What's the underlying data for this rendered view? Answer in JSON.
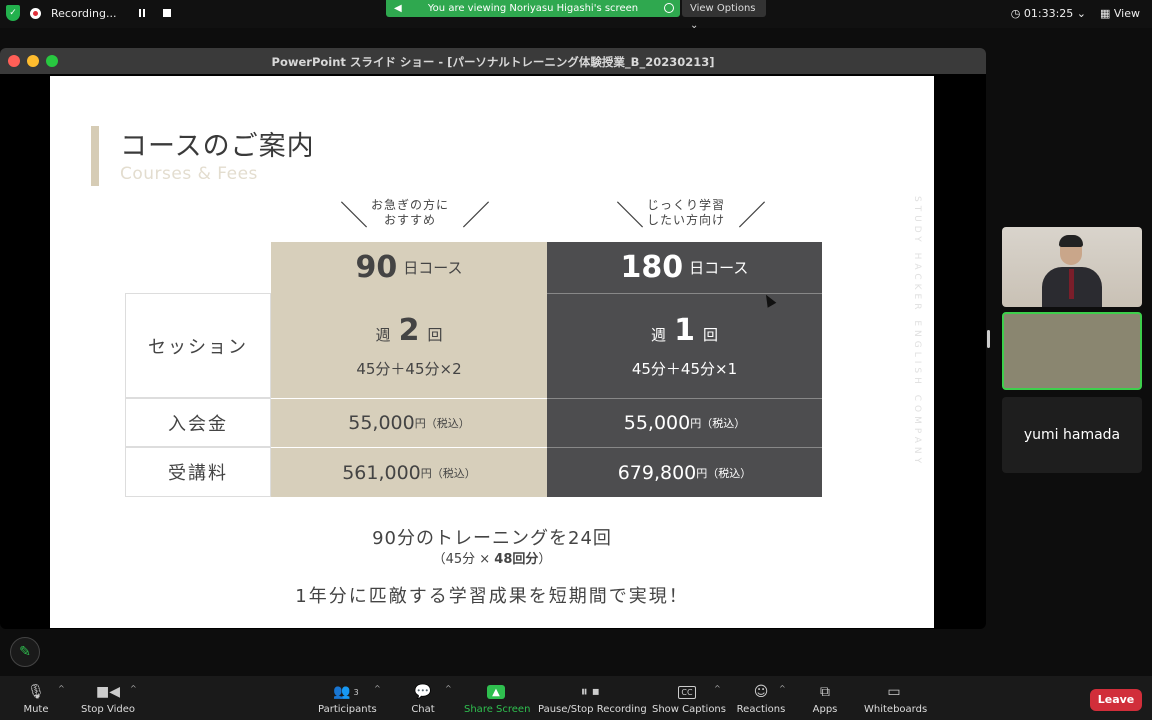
{
  "top_bar": {
    "recording_label": "Recording...",
    "viewing_banner": "You are viewing Noriyasu Higashi's screen",
    "view_options_label": "View Options",
    "elapsed_time": "01:33:25",
    "view_label": "View"
  },
  "shared_window": {
    "title": "PowerPoint スライド ショー - [パーソナルトレーニング体験授業_B_20230213]"
  },
  "slide": {
    "title": "コースのご案内",
    "subtitle": "Courses & Fees",
    "vertical_brand": "STUDY HACKER ENGLISH COMPANY",
    "columns": [
      {
        "recommend": [
          "お急ぎの方に",
          "おすすめ"
        ],
        "course_num": "90",
        "course_suffix": "日コース",
        "session_pre": "週",
        "session_num": "2",
        "session_post": "回",
        "session_formula": "45分＋45分×2",
        "entrance_fee": "55,000",
        "entrance_unit": "円（税込）",
        "tuition_fee": "561,000",
        "tuition_unit": "円（税込）"
      },
      {
        "recommend": [
          "じっくり学習",
          "したい方向け"
        ],
        "course_num": "180",
        "course_suffix": "日コース",
        "session_pre": "週",
        "session_num": "1",
        "session_post": "回",
        "session_formula": "45分＋45分×1",
        "entrance_fee": "55,000",
        "entrance_unit": "円（税込）",
        "tuition_fee": "679,800",
        "tuition_unit": "円（税込）"
      }
    ],
    "row_labels": {
      "session": "セッション",
      "entrance": "入会金",
      "tuition": "受講料"
    },
    "summary_line1": "90分のトレーニングを24回",
    "summary_line2_pre": "（45分 × ",
    "summary_line2_bold": "48回分",
    "summary_line2_post": "）",
    "summary_line3": "1年分に匹敵する学習成果を短期間で実現！"
  },
  "participants": {
    "name_tile": "yumi hamada"
  },
  "toolbar": {
    "mute": "Mute",
    "stop_video": "Stop Video",
    "participants": "Participants",
    "participants_count": "3",
    "chat": "Chat",
    "share_screen": "Share Screen",
    "pause_stop_recording": "Pause/Stop Recording",
    "show_captions": "Show Captions",
    "reactions": "Reactions",
    "apps": "Apps",
    "whiteboards": "Whiteboards",
    "leave": "Leave"
  },
  "colors": {
    "share_green": "#2fbf4f",
    "leave_red": "#d12e3a",
    "beige": "#d7cfbb",
    "dark_cell": "#4d4d4f"
  }
}
